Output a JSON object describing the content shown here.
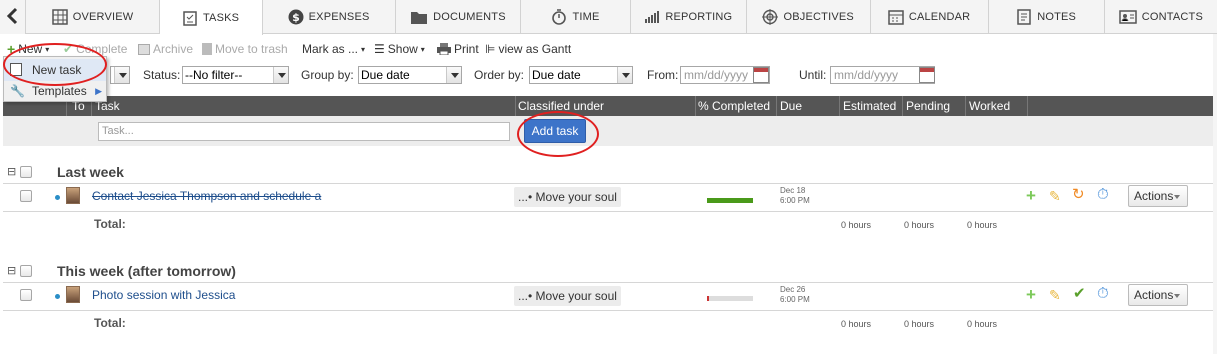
{
  "tabs": [
    {
      "label": "OVERVIEW",
      "icon": "grid-icon"
    },
    {
      "label": "TASKS",
      "icon": "clipboard-icon"
    },
    {
      "label": "EXPENSES",
      "icon": "dollar-icon"
    },
    {
      "label": "DOCUMENTS",
      "icon": "folder-icon"
    },
    {
      "label": "TIME",
      "icon": "stopwatch-icon"
    },
    {
      "label": "REPORTING",
      "icon": "bar-chart-icon"
    },
    {
      "label": "OBJECTIVES",
      "icon": "target-icon"
    },
    {
      "label": "CALENDAR",
      "icon": "calendar-icon"
    },
    {
      "label": "NOTES",
      "icon": "notes-icon"
    },
    {
      "label": "CONTACTS",
      "icon": "contact-card-icon"
    }
  ],
  "toolbar": {
    "new": "New",
    "complete": "Complete",
    "archive": "Archive",
    "move_to_trash": "Move to trash",
    "mark_as": "Mark as ...",
    "show": "Show",
    "print": "Print",
    "view_gantt": "view as Gantt"
  },
  "new_menu": {
    "new_task": "New task",
    "templates": "Templates"
  },
  "filters": {
    "status_label": "Status:",
    "status_value": "--No filter--",
    "group_by_label": "Group by:",
    "group_by_value": "Due date",
    "order_by_label": "Order by:",
    "order_by_value": "Due date",
    "from_label": "From:",
    "from_placeholder": "mm/dd/yyyy",
    "until_label": "Until:",
    "until_placeholder": "mm/dd/yyyy"
  },
  "columns": {
    "to": "To",
    "task": "Task",
    "classified": "Classified under",
    "pct": "% Completed",
    "due": "Due",
    "estimated": "Estimated",
    "pending": "Pending",
    "worked": "Worked"
  },
  "new_row": {
    "task_placeholder": "Task...",
    "add_task": "Add task"
  },
  "groups": [
    {
      "title": "Last week",
      "task": {
        "name": "Contact Jessica Thompson and schedule a",
        "classified": "...• Move your soul",
        "progress": 1.0,
        "progress_color": "#4a9a1a",
        "due_date": "Dec 18",
        "due_time": "6:00 PM",
        "actions": "Actions"
      },
      "total_label": "Total:",
      "estimated": "0 hours",
      "pending": "0 hours",
      "worked": "0 hours"
    },
    {
      "title": "This week (after tomorrow)",
      "task": {
        "name": "Photo session with Jessica",
        "classified": "...• Move your soul",
        "progress": 0.03,
        "progress_color": "#c33",
        "due_date": "Dec 26",
        "due_time": "6:00 PM",
        "actions": "Actions"
      },
      "total_label": "Total:",
      "estimated": "0 hours",
      "pending": "0 hours",
      "worked": "0 hours"
    }
  ]
}
